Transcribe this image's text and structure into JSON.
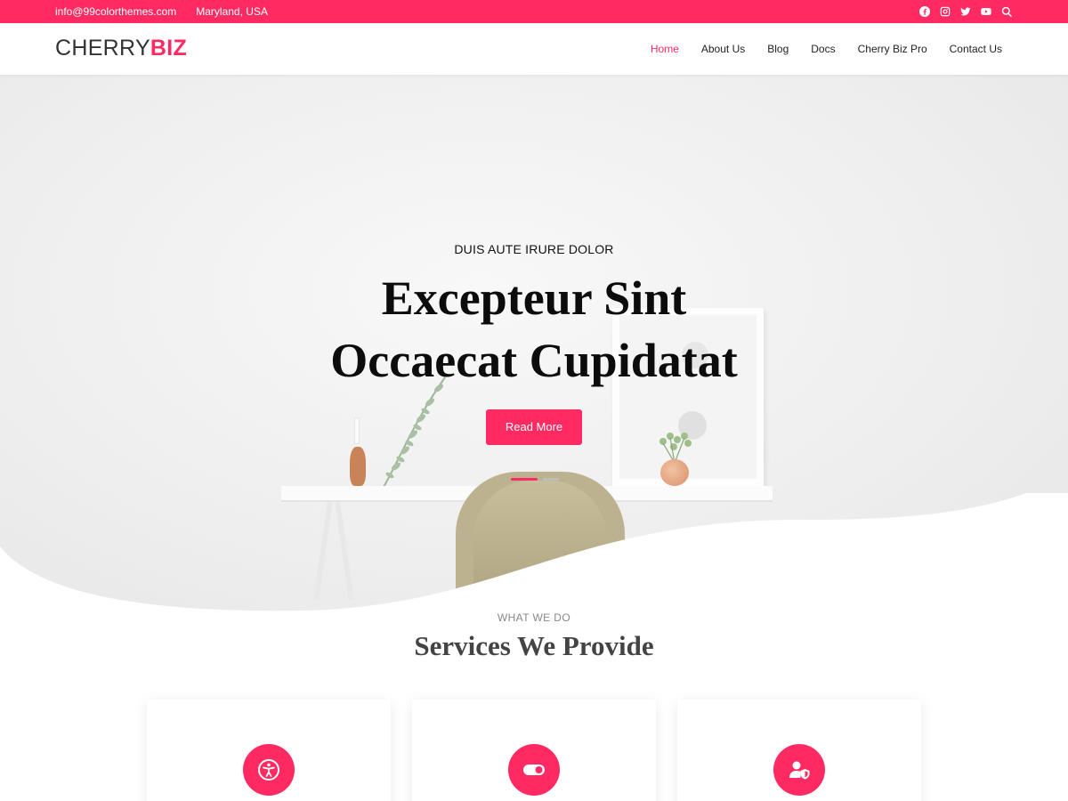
{
  "topbar": {
    "email": "info@99colorthemes.com",
    "location": "Maryland, USA",
    "social_icons": [
      "facebook-icon",
      "instagram-icon",
      "twitter-icon",
      "youtube-icon",
      "search-icon"
    ]
  },
  "header": {
    "logo_part1": "CHERRY",
    "logo_part2": "BIZ",
    "nav": [
      {
        "label": "Home",
        "active": true
      },
      {
        "label": "About Us"
      },
      {
        "label": "Blog"
      },
      {
        "label": "Docs"
      },
      {
        "label": "Cherry Biz Pro"
      },
      {
        "label": "Contact Us"
      }
    ]
  },
  "hero": {
    "kicker": "DUIS AUTE IRURE DOLOR",
    "headline_line1": "Excepteur Sint",
    "headline_line2": "Occaecat Cupidatat",
    "cta_label": "Read More",
    "slides_total": 2,
    "slide_active": 1
  },
  "services": {
    "kicker": "WHAT WE DO",
    "title": "Services We Provide",
    "cards": [
      {
        "icon": "accessibility-icon"
      },
      {
        "icon": "toggle-icon"
      },
      {
        "icon": "user-shield-icon"
      }
    ]
  },
  "colors": {
    "accent": "#ff2a62",
    "text_dark": "#222222",
    "heading_gray": "#444444",
    "hero_bg": "#f3f3f3"
  }
}
